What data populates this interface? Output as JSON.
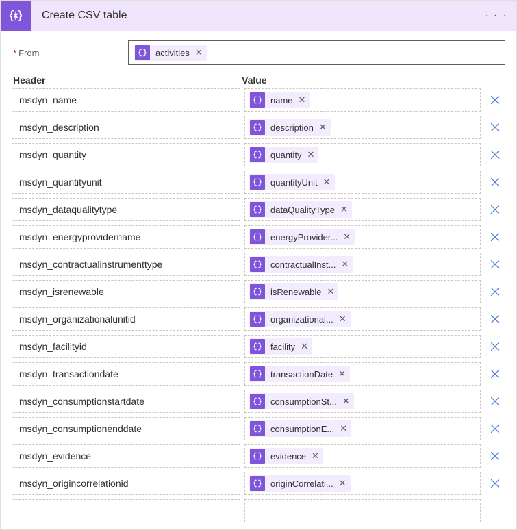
{
  "header": {
    "title": "Create CSV table"
  },
  "from": {
    "label": "From",
    "token": "activities"
  },
  "columns": {
    "header_label": "Header",
    "value_label": "Value"
  },
  "rows": [
    {
      "header": "msdyn_name",
      "value": "name"
    },
    {
      "header": "msdyn_description",
      "value": "description"
    },
    {
      "header": "msdyn_quantity",
      "value": "quantity"
    },
    {
      "header": "msdyn_quantityunit",
      "value": "quantityUnit"
    },
    {
      "header": "msdyn_dataqualitytype",
      "value": "dataQualityType"
    },
    {
      "header": "msdyn_energyprovidername",
      "value": "energyProvider..."
    },
    {
      "header": "msdyn_contractualinstrumenttype",
      "value": "contractualInst..."
    },
    {
      "header": "msdyn_isrenewable",
      "value": "isRenewable"
    },
    {
      "header": "msdyn_organizationalunitid",
      "value": "organizational..."
    },
    {
      "header": "msdyn_facilityid",
      "value": "facility"
    },
    {
      "header": "msdyn_transactiondate",
      "value": "transactionDate"
    },
    {
      "header": "msdyn_consumptionstartdate",
      "value": "consumptionSt..."
    },
    {
      "header": "msdyn_consumptionenddate",
      "value": "consumptionE..."
    },
    {
      "header": "msdyn_evidence",
      "value": "evidence"
    },
    {
      "header": "msdyn_origincorrelationid",
      "value": "originCorrelati..."
    }
  ]
}
